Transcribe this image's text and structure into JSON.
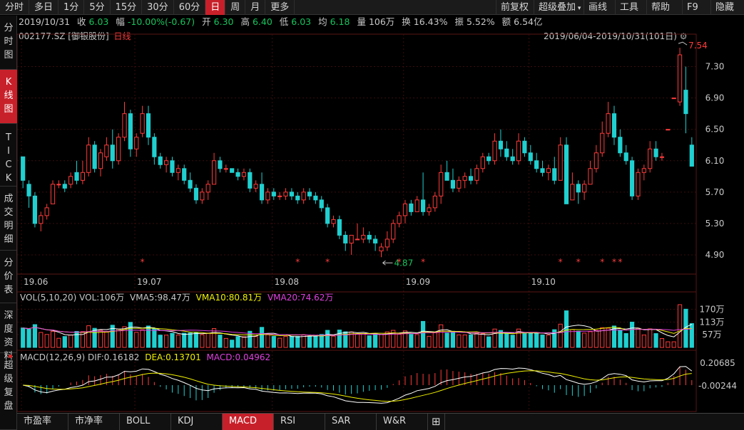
{
  "toolbar": {
    "tabs": [
      {
        "label": "分时",
        "active": false
      },
      {
        "label": "多日",
        "active": false
      },
      {
        "label": "1分",
        "active": false
      },
      {
        "label": "5分",
        "active": false
      },
      {
        "label": "15分",
        "active": false
      },
      {
        "label": "30分",
        "active": false
      },
      {
        "label": "60分",
        "active": false
      },
      {
        "label": "日",
        "active": true
      },
      {
        "label": "周",
        "active": false
      },
      {
        "label": "月",
        "active": false
      },
      {
        "label": "更多",
        "active": false
      }
    ],
    "right": [
      "前复权",
      "超级叠加",
      "画线",
      "工具",
      "帮助",
      "F9",
      "隐藏"
    ]
  },
  "sidebar": {
    "tabs": [
      {
        "label": "分时图",
        "active": false
      },
      {
        "label": "K线图",
        "active": true
      },
      {
        "label": "TICK",
        "active": false
      },
      {
        "label": "成交明细",
        "active": false
      },
      {
        "label": "分价表",
        "active": false
      },
      {
        "label": "深度资料",
        "active": false
      },
      {
        "label": "超级复盘",
        "active": false
      }
    ]
  },
  "info": {
    "date": "2019/10/31",
    "close_label": "收",
    "close": "6.03",
    "change_label": "幅",
    "change": "-10.00%(-0.67)",
    "open_label": "开",
    "open": "6.30",
    "high_label": "高",
    "high": "6.40",
    "low_label": "低",
    "low": "6.03",
    "avg_label": "均",
    "avg": "6.18",
    "vol_label": "量",
    "vol": "106万",
    "turnover_label": "换",
    "turnover": "16.43%",
    "amplitude_label": "振",
    "amplitude": "5.52%",
    "amount_label": "额",
    "amount": "6.54亿"
  },
  "stock": {
    "code": "002177.SZ",
    "name": "[御银股份]",
    "period": "日线"
  },
  "range_text": "2019/06/04-2019/10/31(101日)",
  "main_chart": {
    "price_ticks": [
      "7.30",
      "6.90",
      "6.50",
      "6.10",
      "5.70",
      "5.30",
      "4.90"
    ],
    "max_label": "7.54",
    "min_label": "4.87",
    "date_ticks": [
      "19.06",
      "19.07",
      "19.08",
      "19.09",
      "19.10"
    ]
  },
  "vol_panel": {
    "title": "VOL(5,10,20)",
    "vol": "VOL:106万",
    "vma5": "VMA5:98.47万",
    "vma10": "VMA10:80.81万",
    "vma20": "VMA20:74.62万",
    "ticks": [
      "170万",
      "113万",
      "57万"
    ]
  },
  "macd_panel": {
    "title": "MACD(12,26,9)",
    "dif": "DIF:0.16182",
    "dea": "DEA:0.13701",
    "macd": "MACD:0.04962",
    "ticks": [
      "0.20685",
      "-0.00244"
    ]
  },
  "bottom_tabs": [
    {
      "label": "市盈率",
      "active": false
    },
    {
      "label": "市净率",
      "active": false
    },
    {
      "label": "BOLL",
      "active": false
    },
    {
      "label": "KDJ",
      "active": false
    },
    {
      "label": "MACD",
      "active": true
    },
    {
      "label": "RSI",
      "active": false
    },
    {
      "label": "SAR",
      "active": false
    },
    {
      "label": "W&R",
      "active": false
    }
  ],
  "colors": {
    "up": "#ff3b3b",
    "down": "#20d0d0",
    "dif": "#ffffff",
    "dea": "#f0f000",
    "vma20": "#e040e0",
    "active": "#c8202a"
  },
  "chart_data": {
    "type": "candlestick",
    "range": "2019/06/04-2019/10/31",
    "ohlc": [
      [
        6.15,
        6.15,
        5.75,
        5.85
      ],
      [
        5.8,
        5.85,
        5.5,
        5.65
      ],
      [
        5.65,
        5.7,
        5.25,
        5.3
      ],
      [
        5.3,
        5.45,
        5.2,
        5.4
      ],
      [
        5.4,
        5.55,
        5.35,
        5.5
      ],
      [
        5.55,
        5.85,
        5.55,
        5.8
      ],
      [
        5.8,
        5.85,
        5.75,
        5.8
      ],
      [
        5.8,
        5.85,
        5.7,
        5.75
      ],
      [
        5.8,
        5.95,
        5.75,
        5.9
      ],
      [
        5.95,
        6.1,
        5.8,
        5.85
      ],
      [
        5.85,
        6.1,
        5.8,
        5.95
      ],
      [
        5.95,
        6.4,
        5.9,
        6.3
      ],
      [
        6.3,
        6.35,
        5.95,
        6.0
      ],
      [
        6.0,
        6.25,
        5.9,
        6.2
      ],
      [
        6.15,
        6.4,
        6.1,
        6.3
      ],
      [
        6.3,
        6.5,
        6.0,
        6.1
      ],
      [
        6.1,
        6.45,
        6.05,
        6.4
      ],
      [
        6.4,
        6.85,
        6.35,
        6.7
      ],
      [
        6.7,
        6.75,
        6.15,
        6.25
      ],
      [
        6.25,
        6.45,
        6.15,
        6.4
      ],
      [
        6.45,
        6.8,
        6.4,
        6.7
      ],
      [
        6.7,
        6.8,
        6.3,
        6.4
      ],
      [
        6.4,
        6.45,
        6.05,
        6.15
      ],
      [
        6.15,
        6.2,
        6.0,
        6.05
      ],
      [
        6.05,
        6.15,
        5.95,
        6.1
      ],
      [
        6.1,
        6.15,
        5.9,
        5.95
      ],
      [
        5.95,
        6.05,
        5.85,
        6.0
      ],
      [
        6.0,
        6.05,
        5.8,
        5.85
      ],
      [
        5.85,
        5.95,
        5.7,
        5.75
      ],
      [
        5.75,
        5.8,
        5.55,
        5.6
      ],
      [
        5.6,
        5.75,
        5.55,
        5.7
      ],
      [
        5.7,
        5.85,
        5.6,
        5.8
      ],
      [
        5.8,
        6.2,
        5.8,
        6.1
      ],
      [
        6.1,
        6.15,
        5.95,
        6.0
      ],
      [
        6.0,
        6.05,
        5.95,
        6.0
      ],
      [
        6.0,
        6.0,
        5.95,
        5.95
      ],
      [
        5.95,
        6.0,
        5.85,
        5.9
      ],
      [
        5.9,
        6.0,
        5.85,
        5.95
      ],
      [
        5.95,
        6.0,
        5.7,
        5.75
      ],
      [
        5.75,
        5.85,
        5.7,
        5.8
      ],
      [
        5.8,
        5.95,
        5.55,
        5.6
      ],
      [
        5.6,
        5.75,
        5.55,
        5.7
      ],
      [
        5.7,
        5.75,
        5.6,
        5.65
      ],
      [
        5.65,
        5.7,
        5.6,
        5.65
      ],
      [
        5.65,
        5.75,
        5.6,
        5.7
      ],
      [
        5.7,
        5.75,
        5.6,
        5.65
      ],
      [
        5.65,
        5.7,
        5.55,
        5.6
      ],
      [
        5.6,
        5.75,
        5.55,
        5.7
      ],
      [
        5.7,
        5.75,
        5.6,
        5.65
      ],
      [
        5.65,
        5.7,
        5.55,
        5.6
      ],
      [
        5.6,
        5.65,
        5.45,
        5.5
      ],
      [
        5.5,
        5.55,
        5.25,
        5.3
      ],
      [
        5.3,
        5.4,
        5.25,
        5.35
      ],
      [
        5.35,
        5.4,
        5.1,
        5.15
      ],
      [
        5.15,
        5.2,
        4.95,
        5.05
      ],
      [
        5.05,
        5.15,
        4.9,
        5.15
      ],
      [
        5.1,
        5.3,
        5.1,
        5.1
      ],
      [
        5.1,
        5.25,
        5.05,
        5.15
      ],
      [
        5.15,
        5.2,
        5.05,
        5.1
      ],
      [
        5.1,
        5.15,
        4.95,
        5.05
      ],
      [
        4.95,
        5.05,
        4.87,
        5.0
      ],
      [
        5.0,
        5.2,
        4.95,
        5.1
      ],
      [
        5.1,
        5.35,
        5.05,
        5.3
      ],
      [
        5.3,
        5.45,
        5.25,
        5.4
      ],
      [
        5.4,
        5.6,
        5.3,
        5.55
      ],
      [
        5.55,
        5.6,
        5.4,
        5.45
      ],
      [
        5.45,
        5.65,
        5.45,
        5.6
      ],
      [
        5.6,
        5.95,
        5.4,
        5.45
      ],
      [
        5.45,
        5.55,
        5.4,
        5.5
      ],
      [
        5.5,
        5.7,
        5.45,
        5.65
      ],
      [
        5.65,
        6.05,
        5.55,
        5.95
      ],
      [
        5.95,
        6.1,
        5.85,
        5.85
      ],
      [
        5.85,
        6.0,
        5.7,
        5.75
      ],
      [
        5.75,
        5.9,
        5.7,
        5.85
      ],
      [
        5.85,
        5.95,
        5.75,
        5.9
      ],
      [
        5.9,
        6.0,
        5.8,
        5.85
      ],
      [
        5.85,
        6.05,
        5.8,
        6.0
      ],
      [
        6.0,
        6.2,
        5.95,
        6.15
      ],
      [
        6.15,
        6.2,
        6.05,
        6.1
      ],
      [
        6.1,
        6.45,
        6.05,
        6.35
      ],
      [
        6.35,
        6.5,
        6.15,
        6.25
      ],
      [
        6.25,
        6.35,
        6.1,
        6.15
      ],
      [
        6.15,
        6.25,
        6.05,
        6.1
      ],
      [
        6.1,
        6.45,
        6.05,
        6.35
      ],
      [
        6.35,
        6.4,
        6.15,
        6.2
      ],
      [
        6.2,
        6.3,
        6.05,
        6.1
      ],
      [
        6.1,
        6.2,
        5.95,
        6.0
      ],
      [
        6.0,
        6.1,
        5.9,
        5.95
      ],
      [
        5.95,
        6.05,
        5.85,
        6.0
      ],
      [
        6.0,
        6.15,
        5.8,
        5.85
      ],
      [
        5.85,
        6.4,
        5.85,
        6.3
      ],
      [
        6.3,
        6.4,
        5.55,
        5.55
      ],
      [
        5.6,
        5.95,
        5.6,
        5.8
      ],
      [
        5.8,
        5.85,
        5.55,
        5.7
      ],
      [
        5.7,
        5.85,
        5.6,
        5.8
      ],
      [
        5.8,
        6.1,
        5.8,
        6.0
      ],
      [
        6.0,
        6.3,
        5.95,
        6.2
      ],
      [
        6.2,
        6.6,
        6.15,
        6.45
      ],
      [
        6.45,
        6.85,
        6.4,
        6.7
      ],
      [
        6.7,
        6.8,
        6.3,
        6.4
      ],
      [
        6.4,
        6.5,
        6.15,
        6.2
      ],
      [
        6.2,
        6.3,
        6.05,
        6.1
      ],
      [
        6.1,
        6.15,
        5.6,
        5.65
      ],
      [
        5.65,
        6.0,
        5.6,
        5.95
      ],
      [
        5.95,
        6.05,
        5.85,
        6.0
      ],
      [
        6.0,
        6.35,
        5.95,
        6.25
      ],
      [
        6.25,
        6.35,
        6.1,
        6.15
      ],
      [
        6.15,
        6.2,
        6.1,
        6.15
      ],
      [
        6.5,
        6.5,
        6.5,
        6.5
      ],
      [
        6.9,
        6.9,
        6.9,
        6.9
      ],
      [
        6.85,
        7.54,
        6.8,
        7.45
      ],
      [
        7.0,
        7.3,
        6.45,
        6.7
      ],
      [
        6.3,
        6.4,
        6.03,
        6.03
      ]
    ]
  }
}
